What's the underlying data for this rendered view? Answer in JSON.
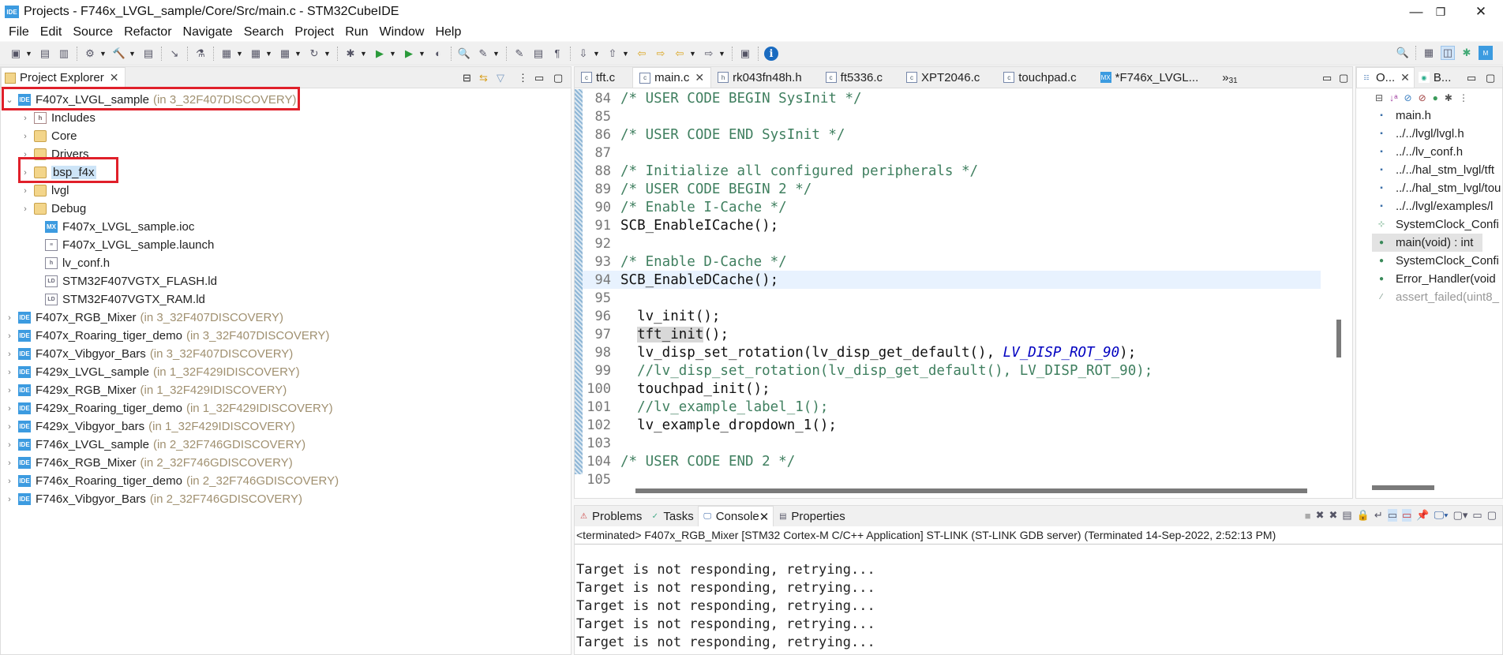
{
  "window": {
    "title": "Projects - F746x_LVGL_sample/Core/Src/main.c - STM32CubeIDE",
    "logo": "IDE",
    "controls": {
      "minimize": "—",
      "restore": "❐",
      "close": "✕"
    }
  },
  "menu": [
    "File",
    "Edit",
    "Source",
    "Refactor",
    "Navigate",
    "Search",
    "Project",
    "Run",
    "Window",
    "Help"
  ],
  "toolbar": {
    "icons": [
      "new-icon",
      "save-icon",
      "save-all-icon",
      "build-config-icon",
      "build-icon",
      "build-doc-icon",
      "debug-target-icon",
      "mx-icon",
      "new-c-project-icon",
      "new-source-icon",
      "new-class-icon",
      "refresh-icon",
      "debug-icon",
      "run-icon",
      "run-external-icon",
      "external-tools-icon",
      "search-icon",
      "pen-icon",
      "annotation-icon",
      "block-icon",
      "paragraph-icon",
      "next-annotation-icon",
      "prev-annotation-icon",
      "last-edit-back-icon",
      "last-edit-forward-icon",
      "back-icon",
      "forward-icon",
      "open-perspective-icon",
      "info-icon"
    ],
    "right_icons": [
      "search-icon",
      "open-perspective-icon",
      "cc-perspective-icon",
      "debug-perspective-icon",
      "mx-perspective-icon"
    ]
  },
  "project_explorer": {
    "title": "Project Explorer",
    "expanded_project": {
      "name": "F407x_LVGL_sample",
      "location": "(in 3_32F407DISCOVERY)"
    },
    "children": [
      {
        "name": "Includes",
        "icon": "includes",
        "expandable": true
      },
      {
        "name": "Core",
        "icon": "folder",
        "expandable": true
      },
      {
        "name": "Drivers",
        "icon": "folder",
        "expandable": true
      },
      {
        "name": "bsp_f4x",
        "icon": "folder",
        "expandable": true,
        "selected": true
      },
      {
        "name": "lvgl",
        "icon": "folder",
        "expandable": true
      },
      {
        "name": "Debug",
        "icon": "folder",
        "expandable": true
      },
      {
        "name": "F407x_LVGL_sample.ioc",
        "icon": "mx",
        "expandable": false
      },
      {
        "name": "F407x_LVGL_sample.launch",
        "icon": "file",
        "expandable": false
      },
      {
        "name": "lv_conf.h",
        "icon": "header",
        "expandable": false
      },
      {
        "name": "STM32F407VGTX_FLASH.ld",
        "icon": "ld",
        "expandable": false
      },
      {
        "name": "STM32F407VGTX_RAM.ld",
        "icon": "ld",
        "expandable": false
      }
    ],
    "projects": [
      {
        "name": "F407x_RGB_Mixer",
        "location": "(in 3_32F407DISCOVERY)"
      },
      {
        "name": "F407x_Roaring_tiger_demo",
        "location": "(in 3_32F407DISCOVERY)"
      },
      {
        "name": "F407x_Vibgyor_Bars",
        "location": "(in 3_32F407DISCOVERY)"
      },
      {
        "name": "F429x_LVGL_sample",
        "location": "(in 1_32F429IDISCOVERY)"
      },
      {
        "name": "F429x_RGB_Mixer",
        "location": "(in 1_32F429IDISCOVERY)"
      },
      {
        "name": "F429x_Roaring_tiger_demo",
        "location": "(in 1_32F429IDISCOVERY)"
      },
      {
        "name": "F429x_Vibgyor_bars",
        "location": "(in 1_32F429IDISCOVERY)"
      },
      {
        "name": "F746x_LVGL_sample",
        "location": "(in 2_32F746GDISCOVERY)"
      },
      {
        "name": "F746x_RGB_Mixer",
        "location": "(in 2_32F746GDISCOVERY)"
      },
      {
        "name": "F746x_Roaring_tiger_demo",
        "location": "(in 2_32F746GDISCOVERY)"
      },
      {
        "name": "F746x_Vibgyor_Bars",
        "location": "(in 2_32F746GDISCOVERY)"
      }
    ]
  },
  "editor": {
    "tabs": [
      {
        "label": "tft.c",
        "icon": "c"
      },
      {
        "label": "main.c",
        "icon": "c",
        "active": true
      },
      {
        "label": "rk043fn48h.h",
        "icon": "h"
      },
      {
        "label": "ft5336.c",
        "icon": "c"
      },
      {
        "label": "XPT2046.c",
        "icon": "c"
      },
      {
        "label": "touchpad.c",
        "icon": "c"
      },
      {
        "label": "*F746x_LVGL...",
        "icon": "mx"
      }
    ],
    "overflow_label": "»",
    "overflow_count": "31",
    "lines": [
      {
        "n": "84",
        "text": "/* USER CODE BEGIN SysInit */",
        "kind": "comment"
      },
      {
        "n": "85",
        "text": "",
        "kind": "code"
      },
      {
        "n": "86",
        "text": "/* USER CODE END SysInit */",
        "kind": "comment"
      },
      {
        "n": "87",
        "text": "",
        "kind": "code"
      },
      {
        "n": "88",
        "text": "/* Initialize all configured peripherals */",
        "kind": "comment"
      },
      {
        "n": "89",
        "text": "/* USER CODE BEGIN 2 */",
        "kind": "comment"
      },
      {
        "n": "90",
        "text": "/* Enable I-Cache */",
        "kind": "comment"
      },
      {
        "n": "91",
        "text": "SCB_EnableICache();",
        "kind": "code"
      },
      {
        "n": "92",
        "text": "",
        "kind": "code"
      },
      {
        "n": "93",
        "text": "/* Enable D-Cache */",
        "kind": "comment"
      },
      {
        "n": "94",
        "text": "SCB_EnableDCache();",
        "kind": "code",
        "current": true
      },
      {
        "n": "95",
        "text": "",
        "kind": "code"
      },
      {
        "n": "96",
        "text": "  lv_init();",
        "kind": "code"
      },
      {
        "n": "97",
        "text": "  tft_init();",
        "kind": "code",
        "highlight": "tft_init"
      },
      {
        "n": "98",
        "text": "  lv_disp_set_rotation(lv_disp_get_default(), ",
        "kind": "code",
        "macro": "LV_DISP_ROT_90",
        "tail": ");"
      },
      {
        "n": "99",
        "text": "  //lv_disp_set_rotation(lv_disp_get_default(), LV_DISP_ROT_90);",
        "kind": "comment"
      },
      {
        "n": "100",
        "text": "  touchpad_init();",
        "kind": "code"
      },
      {
        "n": "101",
        "text": "  //lv_example_label_1();",
        "kind": "comment"
      },
      {
        "n": "102",
        "text": "  lv_example_dropdown_1();",
        "kind": "code"
      },
      {
        "n": "103",
        "text": "",
        "kind": "code"
      },
      {
        "n": "104",
        "text": "/* USER CODE END 2 */",
        "kind": "comment"
      },
      {
        "n": "105",
        "text": "",
        "kind": "code"
      }
    ]
  },
  "outline": {
    "tabs": [
      {
        "label": "O...",
        "active": true
      },
      {
        "label": "B..."
      }
    ],
    "items": [
      {
        "label": "main.h",
        "icon": "include"
      },
      {
        "label": "../../lvgl/lvgl.h",
        "icon": "include"
      },
      {
        "label": "../../lv_conf.h",
        "icon": "include"
      },
      {
        "label": "../../hal_stm_lvgl/tft",
        "icon": "include"
      },
      {
        "label": "../../hal_stm_lvgl/tou",
        "icon": "include"
      },
      {
        "label": "../../lvgl/examples/l",
        "icon": "include"
      },
      {
        "label": "SystemClock_Confi",
        "icon": "declaration"
      },
      {
        "label": "main(void) : int",
        "icon": "function",
        "selected": true
      },
      {
        "label": "SystemClock_Confi",
        "icon": "function"
      },
      {
        "label": "Error_Handler(void",
        "icon": "function"
      },
      {
        "label": "assert_failed(uint8_",
        "icon": "inactive",
        "disabled": true
      }
    ]
  },
  "console": {
    "tabs": [
      {
        "label": "Problems",
        "icon": "problems"
      },
      {
        "label": "Tasks",
        "icon": "tasks"
      },
      {
        "label": "Console",
        "icon": "console",
        "active": true
      },
      {
        "label": "Properties",
        "icon": "properties"
      }
    ],
    "status": "<terminated> F407x_RGB_Mixer [STM32 Cortex-M C/C++ Application] ST-LINK (ST-LINK GDB server) (Terminated 14-Sep-2022, 2:52:13 PM)",
    "output": [
      "Target is not responding, retrying...",
      "Target is not responding, retrying...",
      "Target is not responding, retrying...",
      "Target is not responding, retrying...",
      "Target is not responding, retrying..."
    ]
  }
}
